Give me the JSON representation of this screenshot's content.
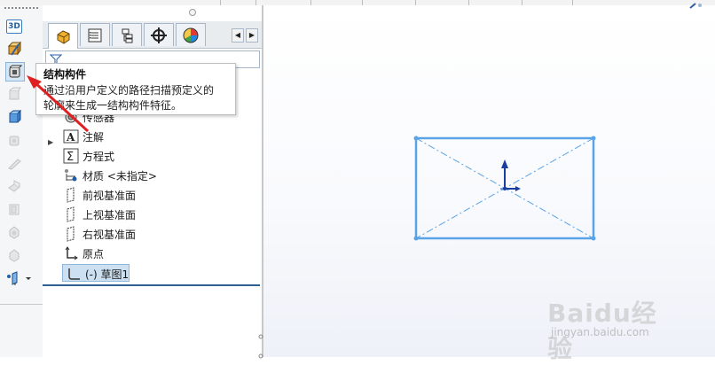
{
  "colors": {
    "sketch_line": "#5aa3e8",
    "arrow_red": "#e02020",
    "axis_blue": "#1a3e9e",
    "selection_bg": "#cde0f2",
    "panel_accent": "#2f5f8f"
  },
  "left_toolbar": {
    "items": [
      {
        "icon": "3d-view-icon",
        "label": "3D"
      },
      {
        "icon": "weldment-icon"
      },
      {
        "icon": "structural-member-icon",
        "selected": true
      },
      {
        "icon": "gusset-icon-disabled"
      },
      {
        "icon": "trim-extend-icon"
      },
      {
        "icon": "end-cap-icon-disabled"
      },
      {
        "icon": "fillet-bead-icon-disabled"
      },
      {
        "icon": "extruded-boss-icon-disabled"
      },
      {
        "icon": "extruded-cut-icon-disabled"
      },
      {
        "icon": "hole-icon-disabled"
      },
      {
        "icon": "chamfer-icon-disabled"
      },
      {
        "icon": "reference-geometry-icon"
      }
    ]
  },
  "feature_manager": {
    "tabs": [
      {
        "icon": "featuremanager-tab-icon",
        "active": true
      },
      {
        "icon": "propertymanager-tab-icon"
      },
      {
        "icon": "configurationmanager-tab-icon"
      },
      {
        "icon": "dimxpert-tab-icon"
      },
      {
        "icon": "displaymanager-tab-icon"
      }
    ],
    "partial_text": ")",
    "tree": [
      {
        "label": "传感器",
        "icon": "sensor-icon"
      },
      {
        "label": "注解",
        "icon": "annotations-icon",
        "expandable": true
      },
      {
        "label": "方程式",
        "icon": "equations-icon"
      },
      {
        "label": "材质 <未指定>",
        "icon": "material-icon"
      },
      {
        "label": "前视基准面",
        "icon": "plane-icon"
      },
      {
        "label": "上视基准面",
        "icon": "plane-icon"
      },
      {
        "label": "右视基准面",
        "icon": "plane-icon"
      },
      {
        "label": "原点",
        "icon": "origin-icon"
      },
      {
        "label": "(-) 草图1",
        "icon": "sketch-icon",
        "selected": true
      }
    ]
  },
  "tooltip": {
    "title": "结构构件",
    "description_line1": "通过沿用户定义的路径扫描预定义的",
    "description_line2": "轮廓来生成一结构构件特征。"
  },
  "watermark": {
    "brand": "Baidu经验",
    "url": "jingyan.baidu.com"
  }
}
